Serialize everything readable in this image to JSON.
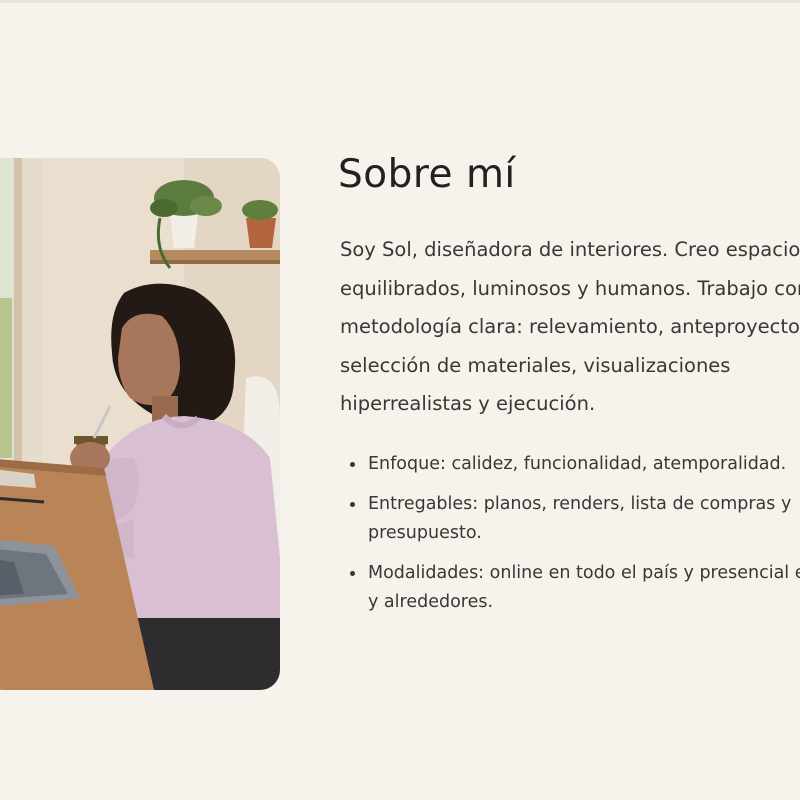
{
  "about": {
    "title": "Sobre mí",
    "bio": "Soy Sol, diseñadora de interiores. Creo espacios equilibrados, luminosos y humanos. Trabajo con una metodología clara: relevamiento, anteproyecto, selección de materiales, visualizaciones hiperrealistas y ejecución.",
    "photo_alt": "Sol tomando mate frente a su laptop",
    "highlights": [
      "Enfoque: calidez, funcionalidad, atemporalidad.",
      "Entregables: planos, renders, lista de compras y presupuesto.",
      "Modalidades: online en todo el país y presencial en VGB y alrededores."
    ]
  },
  "colors": {
    "background": "#f6f2ec",
    "text": "#2c2a27",
    "sweater": "#d8c0d2",
    "wall": "#e9ddcd",
    "desk": "#b98458"
  }
}
